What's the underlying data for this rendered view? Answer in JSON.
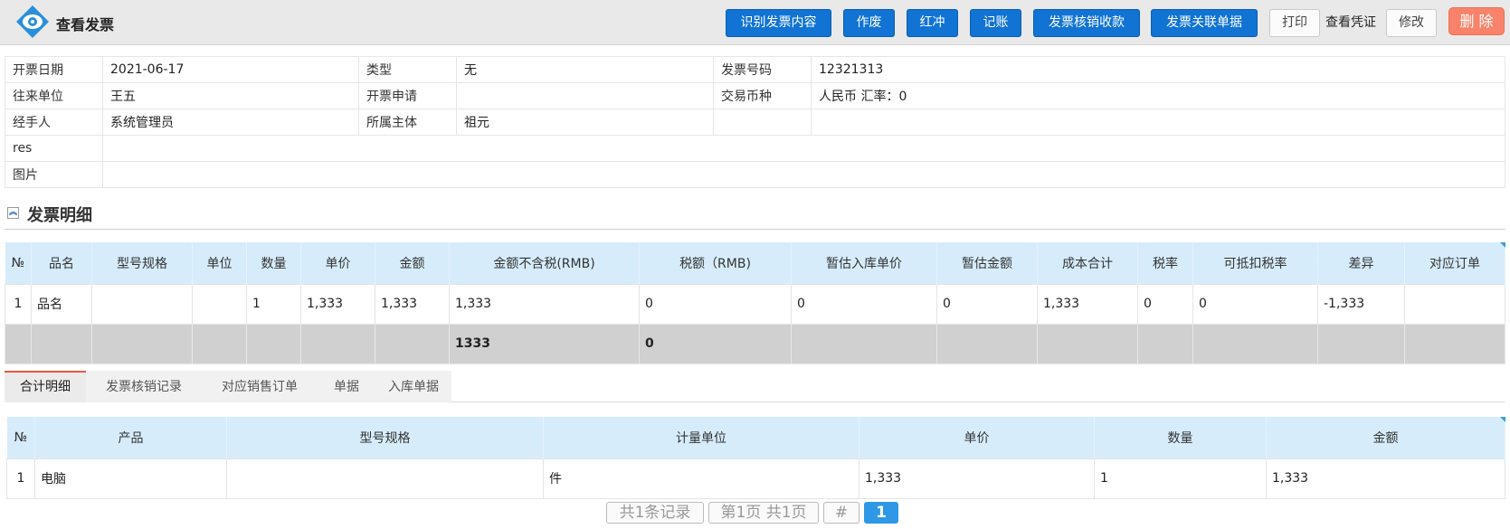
{
  "header": {
    "title": "查看发票",
    "buttons": {
      "recognize": "识别发票内容",
      "void": "作废",
      "red_offset": "红冲",
      "post": "记账",
      "verify_receipt": "发票核销收款",
      "link_docs": "发票关联单据",
      "print": "打印",
      "view_voucher": "查看凭证",
      "edit": "修改",
      "delete": "删 除"
    },
    "colors": {
      "primary": "#1173d3",
      "danger": "#f8836a"
    }
  },
  "info": {
    "invoice_date_label": "开票日期",
    "invoice_date": "2021-06-17",
    "type_label": "类型",
    "type": "无",
    "invoice_no_label": "发票号码",
    "invoice_no": "12321313",
    "party_label": "往来单位",
    "party": "王五",
    "apply_label": "开票申请",
    "apply": "",
    "currency_label": "交易币种",
    "currency": "人民币 汇率：0",
    "handler_label": "经手人",
    "handler": "系统管理员",
    "entity_label": "所属主体",
    "entity": "祖元",
    "res_label": "res",
    "res": "",
    "image_label": "图片",
    "image": ""
  },
  "detail": {
    "section_title": "发票明细",
    "columns": [
      "№",
      "品名",
      "型号规格",
      "单位",
      "数量",
      "单价",
      "金额",
      "金额不含税(RMB)",
      "税额（RMB)",
      "暂估入库单价",
      "暂估金额",
      "成本合计",
      "税率",
      "可抵扣税率",
      "差异",
      "对应订单"
    ],
    "rows": [
      [
        "1",
        "品名",
        "",
        "",
        "1",
        "1,333",
        "1,333",
        "1,333",
        "0",
        "0",
        "0",
        "1,333",
        "0",
        "0",
        "-1,333",
        ""
      ]
    ],
    "sum": [
      "",
      "",
      "",
      "",
      "",
      "",
      "",
      "1333",
      "0",
      "",
      "",
      "",
      "",
      "",
      "",
      ""
    ]
  },
  "tabs": [
    "合计明细",
    "发票核销记录",
    "对应销售订单",
    "单据",
    "入库单据"
  ],
  "summary": {
    "columns": [
      "№",
      "产品",
      "型号规格",
      "计量单位",
      "单价",
      "数量",
      "金额"
    ],
    "rows": [
      [
        "1",
        "电脑",
        "",
        "件",
        "1,333",
        "1",
        "1,333"
      ]
    ]
  },
  "pager": {
    "total": "共1条记录",
    "page_info": "第1页 共1页",
    "hash": "#",
    "current": "1"
  }
}
